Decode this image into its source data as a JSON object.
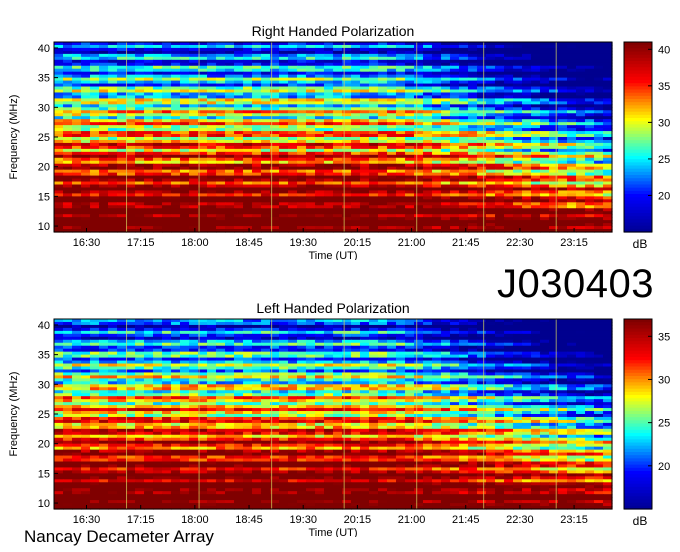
{
  "chart_data": [
    {
      "type": "heatmap",
      "title": "Right Handed Polarization",
      "xlabel": "Time (UT)",
      "ylabel": "Frequency (MHz)",
      "x_ticks": [
        "16:30",
        "17:15",
        "18:00",
        "18:45",
        "19:30",
        "20:15",
        "21:00",
        "21:45",
        "22:30",
        "23:15"
      ],
      "y_ticks": [
        10,
        15,
        20,
        25,
        30,
        35,
        40
      ],
      "ylim": [
        9,
        41
      ],
      "colorbar": {
        "label": "dB",
        "ticks": [
          20,
          25,
          30,
          35,
          40
        ],
        "range": [
          15,
          41
        ]
      },
      "colormap": [
        "#00008f",
        "#0000ff",
        "#00ffff",
        "#ffff00",
        "#ff0000",
        "#800000"
      ]
    },
    {
      "type": "heatmap",
      "title": "Left Handed Polarization",
      "xlabel": "Time (UT)",
      "ylabel": "Frequency (MHz)",
      "x_ticks": [
        "16:30",
        "17:15",
        "18:00",
        "18:45",
        "19:30",
        "20:15",
        "21:00",
        "21:45",
        "22:30",
        "23:15"
      ],
      "y_ticks": [
        10,
        15,
        20,
        25,
        30,
        35,
        40
      ],
      "ylim": [
        9,
        41
      ],
      "colorbar": {
        "label": "dB",
        "ticks": [
          20,
          25,
          30,
          35
        ],
        "range": [
          15,
          37
        ]
      },
      "colormap": [
        "#00008f",
        "#0000ff",
        "#00ffff",
        "#ffff00",
        "#ff0000",
        "#800000"
      ]
    }
  ],
  "observation_id": "J030403",
  "instrument_label": "Nancay Decameter Array"
}
